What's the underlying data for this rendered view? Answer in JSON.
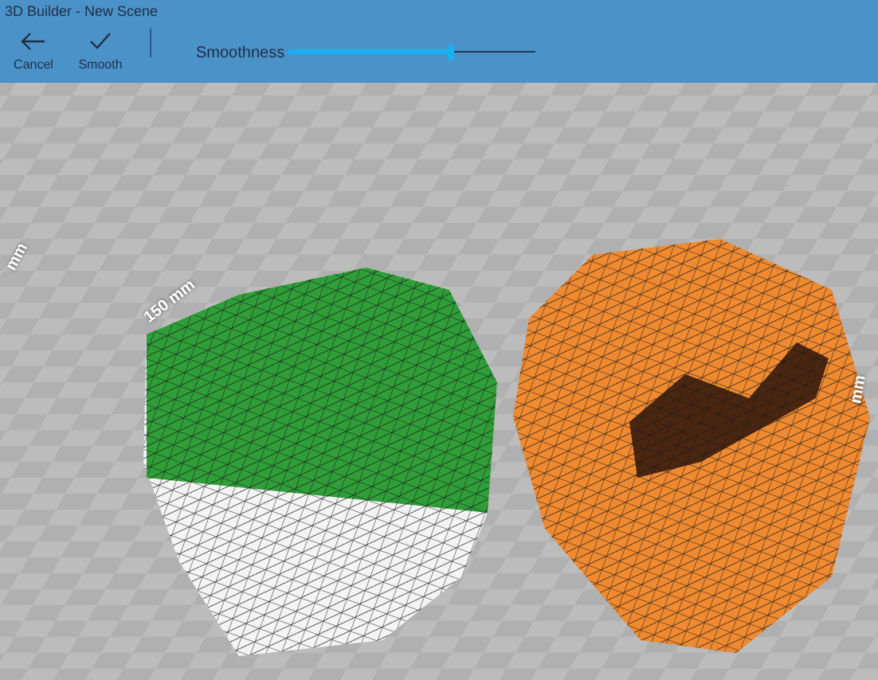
{
  "window": {
    "title": "3D Builder - New Scene"
  },
  "toolbar": {
    "buttons": [
      {
        "kind": "back",
        "label": "Cancel"
      },
      {
        "kind": "check",
        "label": "Smooth"
      }
    ],
    "slider": {
      "label": "Smoothness",
      "level": 0.66
    }
  },
  "floor_labels": {
    "left": "mm",
    "center": "150 mm",
    "right": "mm"
  }
}
